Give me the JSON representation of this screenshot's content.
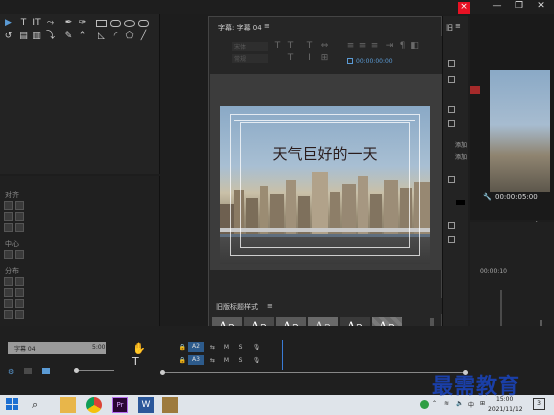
{
  "window": {
    "minimize_label": "—",
    "maximize_label": "❐",
    "close_label": "✕",
    "inner_close_label": "×"
  },
  "left_panel": {
    "align_label": "对齐",
    "center_label": "中心",
    "distribute_label": "分布"
  },
  "title_dialog": {
    "tab_title": "字幕: 字幕 04",
    "menu_label": "≡",
    "font_family_placeholder": "宋体",
    "font_style_placeholder": "常规",
    "timecode": "00:00:00:00",
    "headline": "天气巨好的一天",
    "styles_title": "旧版标题样式",
    "styles_menu": "≡",
    "style_samples": [
      "Aa",
      "Aa",
      "Aa",
      "Aa",
      "Aa",
      "Aa"
    ]
  },
  "right_col": {
    "panel_label": "旧",
    "menu_label": "≡",
    "add_label": "添加",
    "add_label_2": "添加"
  },
  "program_monitor": {
    "timecode": "00:00:05:00",
    "ruler_time": "00:00:10",
    "end_time": "5:00"
  },
  "timeline": {
    "clip_label": "字幕 04",
    "clip_time": "5:00",
    "track_a2": "A2",
    "track_a3": "A3",
    "m_label": "M",
    "s_label": "S"
  },
  "taskbar": {
    "time": "15:00",
    "date": "2021/11/12",
    "notifications": "3"
  },
  "watermark": {
    "text": "最需教育"
  },
  "colors": {
    "accent": "#5b9bd5",
    "close": "#e81123",
    "watermark": "#1a3fa8"
  }
}
